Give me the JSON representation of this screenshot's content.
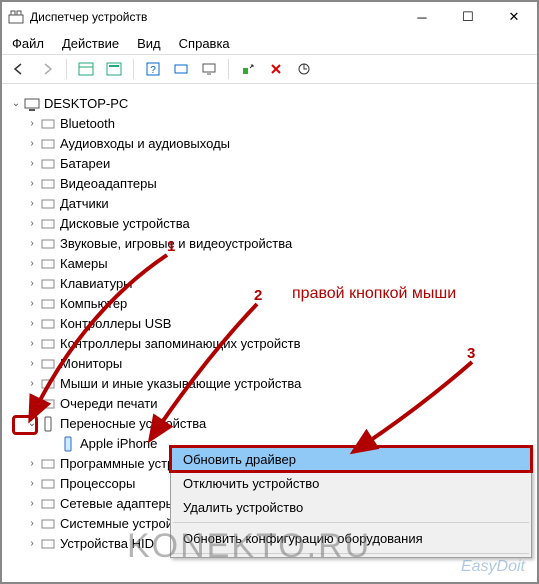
{
  "window": {
    "title": "Диспетчер устройств"
  },
  "menu": {
    "file": "Файл",
    "action": "Действие",
    "view": "Вид",
    "help": "Справка"
  },
  "root": "DESKTOP-PC",
  "categories": [
    "Bluetooth",
    "Аудиовходы и аудиовыходы",
    "Батареи",
    "Видеоадаптеры",
    "Датчики",
    "Дисковые устройства",
    "Звуковые, игровые и видеоустройства",
    "Камеры",
    "Клавиатуры",
    "Компьютер",
    "Контроллеры USB",
    "Контроллеры запоминающих устройств",
    "Мониторы",
    "Мыши и иные указывающие устройства",
    "Очереди печати"
  ],
  "portable": {
    "label": "Переносные устройства",
    "child": "Apple iPhone"
  },
  "after": [
    "Программные устройства",
    "Процессоры",
    "Сетевые адаптеры",
    "Системные устройства",
    "Устройства HID"
  ],
  "context": {
    "update": "Обновить драйвер",
    "disable": "Отключить устройство",
    "uninstall": "Удалить устройство",
    "scan": "Обновить конфигурацию оборудования"
  },
  "annotations": {
    "n1": "1",
    "n2": "2",
    "n3": "3",
    "hint": "правой кнопкой мыши"
  },
  "watermark": "KONEKTO.RU",
  "watermark2": "EasyDoit"
}
